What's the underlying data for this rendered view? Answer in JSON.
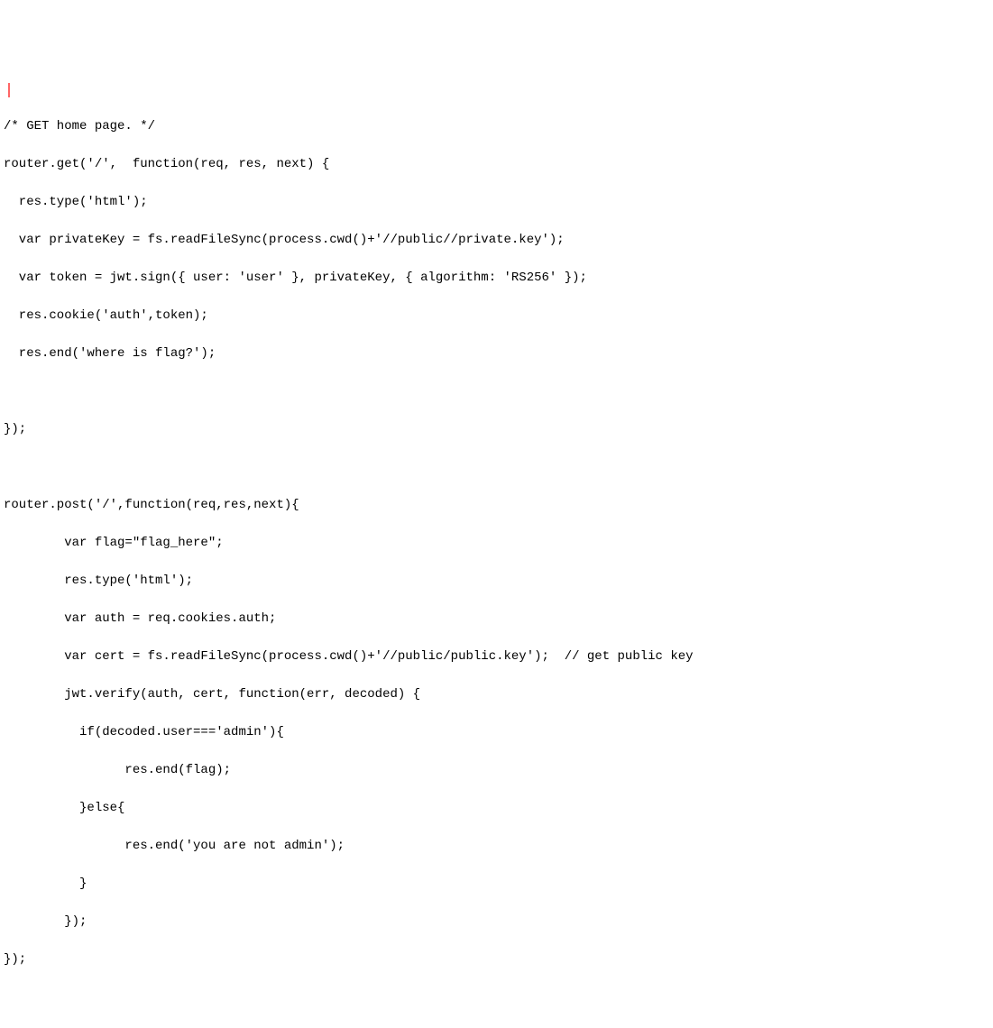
{
  "code": {
    "lines": [
      "/* GET home page. */",
      "router.get('/',  function(req, res, next) {",
      "  res.type('html');",
      "  var privateKey = fs.readFileSync(process.cwd()+'//public//private.key');",
      "  var token = jwt.sign({ user: 'user' }, privateKey, { algorithm: 'RS256' });",
      "  res.cookie('auth',token);",
      "  res.end('where is flag?');",
      "  ",
      "});",
      "",
      "router.post('/',function(req,res,next){",
      "        var flag=\"flag_here\";",
      "        res.type('html');",
      "        var auth = req.cookies.auth;",
      "        var cert = fs.readFileSync(process.cwd()+'//public/public.key');  // get public key",
      "        jwt.verify(auth, cert, function(err, decoded) {",
      "          if(decoded.user==='admin'){",
      "                res.end(flag);",
      "          }else{",
      "                res.end('you are not admin');",
      "          }",
      "        });",
      "});"
    ]
  }
}
